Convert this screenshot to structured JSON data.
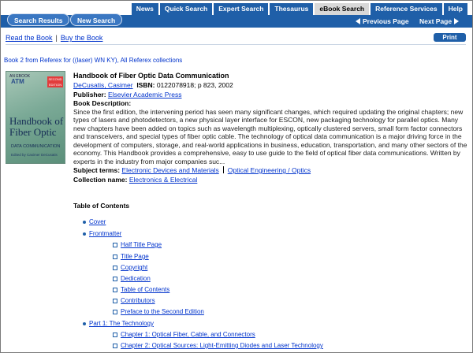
{
  "tabs": [
    "News",
    "Quick Search",
    "Expert Search",
    "Thesaurus",
    "eBook Search",
    "Reference Services",
    "Help"
  ],
  "active_tab": "eBook Search",
  "nav": {
    "search_results": "Search Results",
    "new_search": "New Search",
    "previous_page": "Previous Page",
    "next_page": "Next Page"
  },
  "actions": {
    "read_book": "Read the Book",
    "separator": "|",
    "buy_book": "Buy the Book",
    "print": "Print"
  },
  "breadcrumb": "Book 2 from Referex for ((laser) WN KY), All Referex collections",
  "cover": {
    "top": "AN EBOOK",
    "series": "ATM",
    "badge": "SECOND EDITION",
    "title_line1": "Handbook of",
    "title_line2": "Fiber Optic",
    "subtitle": "DATA COMMUNICATION",
    "editor": "Edited by Casimer DeCusatis"
  },
  "book": {
    "title": "Handbook of Fiber Optic Data Communication",
    "author": "DeCusatis, Casimer",
    "isbn_label": "ISBN:",
    "isbn_value": "0122078918; p 823, 2002",
    "publisher_label": "Publisher:",
    "publisher": "Elsevier Academic Press",
    "description_label": "Book Description:",
    "description": "Since the first edition, the intervening period has seen many significant changes, which required updating the original chapters; new types of lasers and photodetectors, a new physical layer interface for ESCON, new packaging technology for parallel optics. Many new chapters have been added on topics such as wavelength multiplexing, optically clustered servers, small form factor connectors and transceivers, and special types of fiber optic cable. The technology of optical data communication is a major driving force in the development of computers, storage, and real-world applications in business, education, transportation, and many other sectors of the economy. This Handbook provides a comprehensive, easy to use guide to the field of optical fiber data communications. Written by experts in the industry from major companies suc...",
    "subject_terms_label": "Subject terms:",
    "subject_terms": [
      "Electronic Devices and Materials",
      "Optical Engineering / Optics"
    ],
    "collection_label": "Collection name:",
    "collection": "Electronics & Electrical"
  },
  "toc": {
    "heading": "Table of Contents",
    "cover": "Cover",
    "frontmatter": "Frontmatter",
    "frontmatter_items": [
      "Half Title Page",
      "Title Page",
      "Copyright",
      "Dedication",
      "Table of Contents",
      "Contributors",
      "Preface to the Second Edition"
    ],
    "part1": "Part 1: The Technology",
    "part1_items": [
      "Chapter 1: Optical Fiber, Cable, and Connectors",
      "Chapter 2: Optical Sources: Light-Emitting Diodes and Laser Technology"
    ]
  }
}
